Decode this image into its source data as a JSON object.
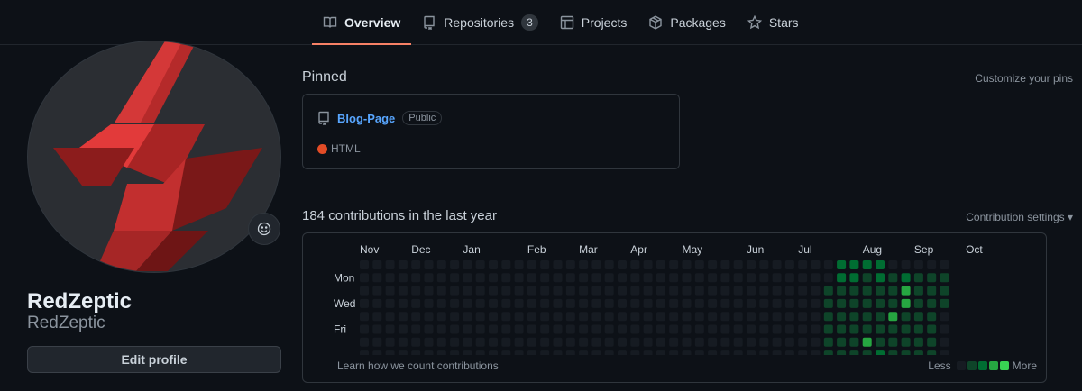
{
  "nav": {
    "tabs": [
      {
        "label": "Overview",
        "icon": "book-icon",
        "active": true
      },
      {
        "label": "Repositories",
        "icon": "repo-icon",
        "count": "3"
      },
      {
        "label": "Projects",
        "icon": "table-icon"
      },
      {
        "label": "Packages",
        "icon": "package-icon"
      },
      {
        "label": "Stars",
        "icon": "star-icon"
      }
    ]
  },
  "profile": {
    "name": "RedZeptic",
    "login": "RedZeptic",
    "edit_label": "Edit profile",
    "avatar_icon": "redzeptic-logo",
    "status_icon": "smiley-icon"
  },
  "pinned": {
    "title": "Pinned",
    "customize_label": "Customize your pins",
    "repos": [
      {
        "name": "Blog-Page",
        "visibility": "Public",
        "language": "HTML",
        "language_color": "#e34c26"
      }
    ]
  },
  "contributions": {
    "title": "184 contributions in the last year",
    "settings_label": "Contribution settings ▾",
    "months": [
      "Nov",
      "Dec",
      "Jan",
      "Feb",
      "Mar",
      "Apr",
      "May",
      "Jun",
      "Jul",
      "Aug",
      "Sep",
      "Oct"
    ],
    "weekday_labels": [
      "Mon",
      "Wed",
      "Fri"
    ],
    "learn_label": "Learn how we count contributions",
    "legend_less": "Less",
    "legend_more": "More",
    "level_colors": [
      "#161b22",
      "#0e4429",
      "#006d32",
      "#26a641",
      "#39d353"
    ],
    "levels": [
      "0000000000000000000000000000000000000222200000",
      "0000000000000000000000000000000000000221212111",
      "0000000000000000000000000000000000001111113111",
      "0000000000000000000000000000000000001111113111",
      "0000000000000000000000000000000000001111131110",
      "0000000000000000000000000000000000001111111110",
      "0000000000000000000000000000000000001113111110",
      "0000000000000000000000000000000000001111211110"
    ]
  }
}
